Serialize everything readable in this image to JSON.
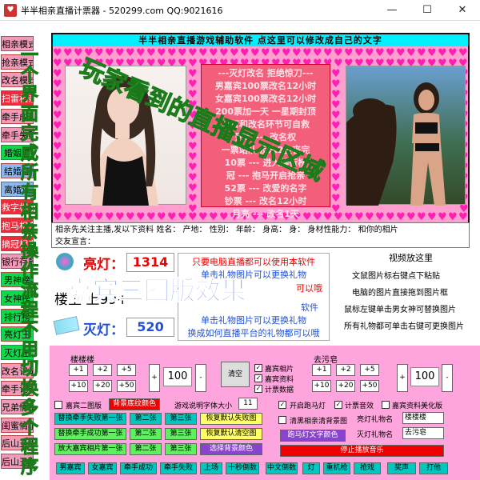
{
  "window": {
    "title": "半半相亲直播计票器 - 520299.com QQ:9021616",
    "icon": "app-icon"
  },
  "sidebar": {
    "items": [
      {
        "label": "相亲模式",
        "style": "s-pink"
      },
      {
        "label": "抢亲模式",
        "style": "s-pink"
      },
      {
        "label": "改名模式",
        "style": "s-pink"
      },
      {
        "label": "扫雷相亲",
        "style": "s-red"
      },
      {
        "label": "牵手成功",
        "style": "s-pink"
      },
      {
        "label": "牵手失败",
        "style": "s-pink"
      },
      {
        "label": "婚姻证",
        "style": "s-grn"
      },
      {
        "label": "结婚证",
        "style": "s-blu"
      },
      {
        "label": "离婚证",
        "style": "s-blu"
      },
      {
        "label": "救字相亲",
        "style": "s-red"
      },
      {
        "label": "抱马相亲",
        "style": "s-red"
      },
      {
        "label": "摘冠相亲",
        "style": "s-red"
      },
      {
        "label": "银行存款",
        "style": "s-pink"
      },
      {
        "label": "男神榜",
        "style": "s-grn"
      },
      {
        "label": "女神榜",
        "style": "s-grn"
      },
      {
        "label": "排行榜",
        "style": "s-grn"
      },
      {
        "label": "亮灯王",
        "style": "s-grn"
      },
      {
        "label": "灭灯王",
        "style": "s-grn"
      },
      {
        "label": "改名记录",
        "style": "s-pink"
      },
      {
        "label": "牵手记录",
        "style": "s-pink"
      },
      {
        "label": "兄弟情谊",
        "style": "s-pink"
      },
      {
        "label": "闺蜜情谊",
        "style": "s-pink"
      },
      {
        "label": "后山丑男",
        "style": "s-pink"
      },
      {
        "label": "后山丑女",
        "style": "s-pink"
      }
    ]
  },
  "header": {
    "title": "半半相亲直播游戏辅助软件        点这里可以修改成自己的文字"
  },
  "notice": {
    "lines": [
      "---灭灯改名 拒绝惊刀---",
      "男嘉宾100票改名12小时",
      "女嘉宾100票改名12小时",
      "200票加一天 一星期封顶",
      "亮灯和改名环节可自救",
      "冠军 --- 改名权",
      "一票站队 反水2金丧完",
      "10票 --- 进入排行榜",
      "冠 --- 抱马开启抢亲",
      "52票 --- 改爱的名字",
      "钞票 --- 改名12小时",
      "月亮 --- 改名1天",
      "鲜花 --- 改名2天",
      "好友王 --- 大鉴"
    ]
  },
  "info": {
    "line1": "相亲先关注主播,发以下资料 姓名：  产地：  性别：  年龄：  身高：  身：  身材性能力：  和你的相片",
    "line2": "交友宣言："
  },
  "votes": {
    "on_label": "亮灯：",
    "on_value": "1314",
    "off_label": "灭灯：",
    "off_value": "520",
    "host_label": "楼主：",
    "host_text": "楼主  上99+"
  },
  "center_text": {
    "red_top": "只要电脑直播都可以使用本软件",
    "blue_top": "单击礼物图片可以更换礼物",
    "red_mid": "可以哦",
    "blue_bot1": "单击礼物图片可以更换礼物",
    "blue_bot2": "换成如何直播平台的礼物都可以哦",
    "purple_right": "软件"
  },
  "right_text": {
    "title": "视频放这里",
    "l1": "文鼠图片标右键点下粘贴",
    "l2": "电脑的图片直接拖到图片框",
    "l3": "鼠标左键单击男女神可替换图片",
    "l4": "所有礼物都可单击右键可更换图片"
  },
  "watermark": {
    "top": "玩家看到的直播显示区域",
    "left": "一个界面完成所有相亲操作流程不用切换多个程序",
    "center": "嘉宾三图版效果"
  },
  "left_counter": {
    "name": "楼楼楼",
    "b1": "+1",
    "b2": "+2",
    "b3": "+5",
    "b4": "+10",
    "b5": "+20",
    "b6": "+50",
    "plus": "+",
    "value": "100",
    "minus": "-"
  },
  "middle_ctrl": {
    "clear": "清空",
    "c1": "嘉宾相片",
    "c2": "嘉宾资料",
    "c3": "计票数据"
  },
  "right_counter": {
    "name": "去污皂",
    "b1": "+1",
    "b2": "+2",
    "b3": "+5",
    "b4": "+10",
    "b5": "+20",
    "b6": "+50",
    "plus": "+",
    "value": "100",
    "minus": "-"
  },
  "options": {
    "guest2": "嘉宾二图版",
    "bgcolor": "背景底纹颜色",
    "fontsize_label": "游戏说明字体大小",
    "fontsize_val": "11",
    "marquee": "开启跑马灯",
    "vote_sound": "计票音效",
    "beautify": "嘉宾资料美化版",
    "clear_chk": "清黑相亲清背景图",
    "light_gift_label": "亮灯礼物名",
    "light_gift_val": "楼楼楼",
    "off_gift_label": "灭灯礼物名",
    "off_gift_val": "去污皂",
    "font_color": "跑马灯文字颜色",
    "stop_btn": "停止播放音乐"
  },
  "tool_rows": [
    {
      "a": "替换牵手失败第一张",
      "b": "第二张",
      "c": "第三张",
      "d": "恢复默认失败图"
    },
    {
      "a": "替换牵手成功第一张",
      "b": "第二张",
      "c": "第三张",
      "d": "恢复默认清空图"
    },
    {
      "a": "放大嘉宾相片第一张",
      "b": "第二张",
      "c": "第三张",
      "d": "选择背景颜色"
    }
  ],
  "bottom_bar": [
    "男嘉宾",
    "女嘉宾",
    "牵手成功",
    "牵手失败",
    "上场",
    "十秒倒数",
    "中文倒数",
    "灯",
    "重机枪",
    "抢戏",
    "奖声",
    "打他"
  ],
  "colors": {
    "header": "#00f0ff",
    "panel_pink": "#ff9fd0",
    "heart": "#ff1fb3",
    "watermark_green": "#3ecf3e",
    "watermark_blue": "#2050d8"
  }
}
